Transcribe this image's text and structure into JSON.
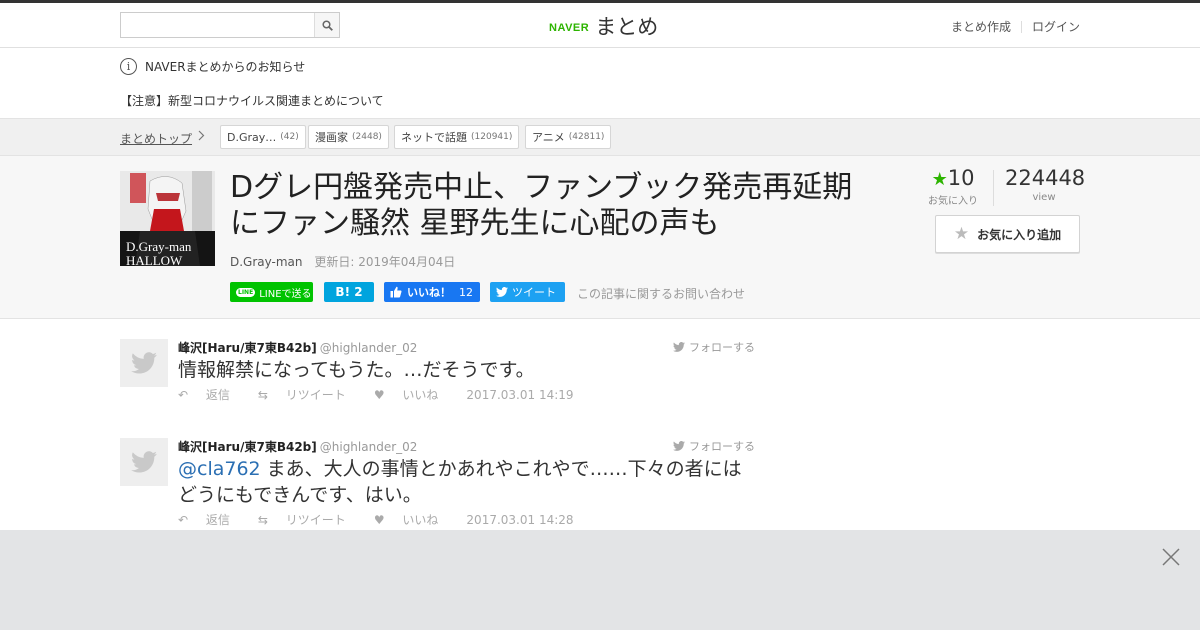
{
  "header": {
    "search_placeholder": "",
    "logo_brand": "NAVER",
    "logo_text": "まとめ",
    "links": [
      "まとめ作成",
      "ログイン"
    ]
  },
  "notices": {
    "title": "NAVERまとめからのお知らせ",
    "item": "【注意】新型コロナウイルス関連まとめについて"
  },
  "breadcrumb": {
    "top": "まとめトップ",
    "tags": [
      {
        "label": "D.Gray…",
        "count": "(42)"
      },
      {
        "label": "漫画家",
        "count": "(2448)"
      },
      {
        "label": "ネットで話題",
        "count": "(120941)"
      },
      {
        "label": "アニメ",
        "count": "(42811)"
      }
    ]
  },
  "article": {
    "thumb_text": "D.Gray-man\nHALLOW",
    "title": "Dグレ円盤発売中止、ファンブック発売再延期にファン騒然 星野先生に心配の声も",
    "category": "D.Gray-man",
    "updated": "更新日: 2019年04月04日",
    "share": {
      "line": "LINEで送る",
      "hatena": "B! 2",
      "like_label": "いいね！",
      "like_count": "12",
      "tweet": "ツイート"
    },
    "contact": "この記事に関するお問い合わせ",
    "favorites": "10",
    "favorites_label": "お気に入り",
    "views": "224448",
    "views_label": "view",
    "fav_button": "お気に入り追加"
  },
  "tweets": [
    {
      "name": "峰沢[Haru/東7東B42b]",
      "handle": "@highlander_02",
      "follow": "フォローする",
      "mention": "",
      "text": "情報解禁になってもうた。…だそうです。",
      "reply": "返信",
      "retweet": "リツイート",
      "like": "いいね",
      "time": "2017.03.01 14:19"
    },
    {
      "name": "峰沢[Haru/東7東B42b]",
      "handle": "@highlander_02",
      "follow": "フォローする",
      "mention": "@cla762",
      "text": " まあ、大人の事情とかあれやこれやで……下々の者にはどうにもできんです、はい。",
      "reply": "返信",
      "retweet": "リツイート",
      "like": "いいね",
      "time": "2017.03.01 14:28"
    }
  ],
  "colors": {
    "brand_green": "#2db400",
    "line_green": "#00c300",
    "hatena_blue": "#00a4de",
    "facebook_blue": "#1877f2",
    "twitter_blue": "#1da1f2",
    "footer_gray": "#e3e4e6"
  }
}
